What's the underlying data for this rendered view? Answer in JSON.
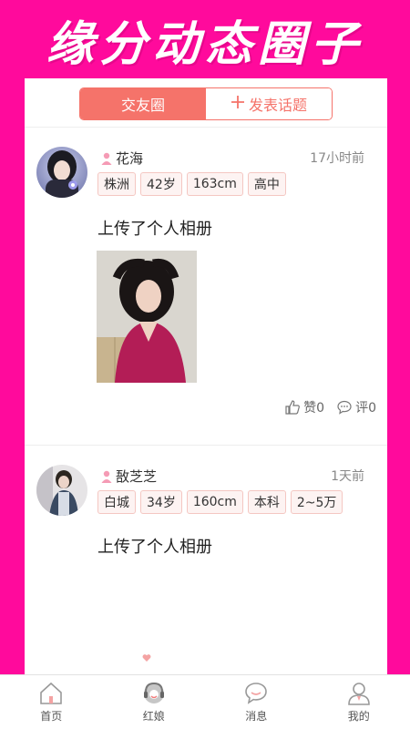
{
  "banner": {
    "title": "缘分动态圈子"
  },
  "tabs": [
    {
      "label": "交友圈",
      "active": true
    },
    {
      "label": "发表话题",
      "active": false,
      "icon": "plus-icon"
    }
  ],
  "posts": [
    {
      "nickname": "花海",
      "time": "17小时前",
      "tags": [
        "株洲",
        "42岁",
        "163cm",
        "高中"
      ],
      "text": "上传了个人相册",
      "likes_label": "赞0",
      "comments_label": "评0"
    },
    {
      "nickname": "敔芝芝",
      "time": "1天前",
      "tags": [
        "白城",
        "34岁",
        "160cm",
        "本科",
        "2~5万"
      ],
      "text": "上传了个人相册"
    }
  ],
  "nav": [
    {
      "label": "首页",
      "icon": "home-icon"
    },
    {
      "label": "红娘",
      "icon": "matchmaker-icon"
    },
    {
      "label": "消息",
      "icon": "message-icon"
    },
    {
      "label": "我的",
      "icon": "profile-icon"
    }
  ],
  "colors": {
    "background": "#ff0a9c",
    "accent": "#f5736a",
    "tag_border": "#f4c7c2",
    "tag_bg": "#fdf3f2"
  }
}
